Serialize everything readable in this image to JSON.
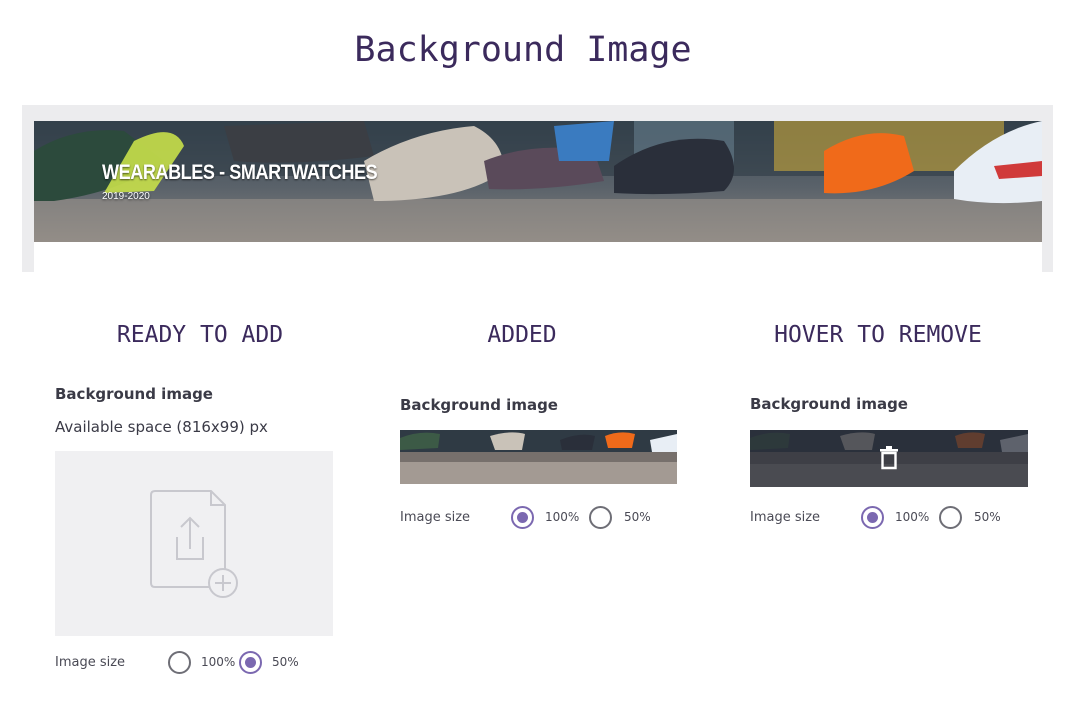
{
  "page": {
    "title": "Background Image"
  },
  "banner": {
    "title": "WEARABLES - SMARTWATCHES",
    "subtitle": "2019-2020"
  },
  "states": {
    "ready": {
      "heading": "READY TO ADD",
      "label": "Background image",
      "hint": "Available space (816x99) px",
      "upload_icon": "file-upload-add-icon",
      "size_label": "Image size",
      "options": [
        "100%",
        "50%"
      ],
      "selected": "50%"
    },
    "added": {
      "heading": "ADDED",
      "label": "Background image",
      "size_label": "Image size",
      "options": [
        "100%",
        "50%"
      ],
      "selected": "100%"
    },
    "hover": {
      "heading": "HOVER TO REMOVE",
      "label": "Background image",
      "remove_icon": "trash-icon",
      "size_label": "Image size",
      "options": [
        "100%",
        "50%"
      ],
      "selected": "100%"
    }
  },
  "colors": {
    "accent": "#7b68b0",
    "heading": "#3b2a5c",
    "dropzone": "#f0f0f2"
  }
}
